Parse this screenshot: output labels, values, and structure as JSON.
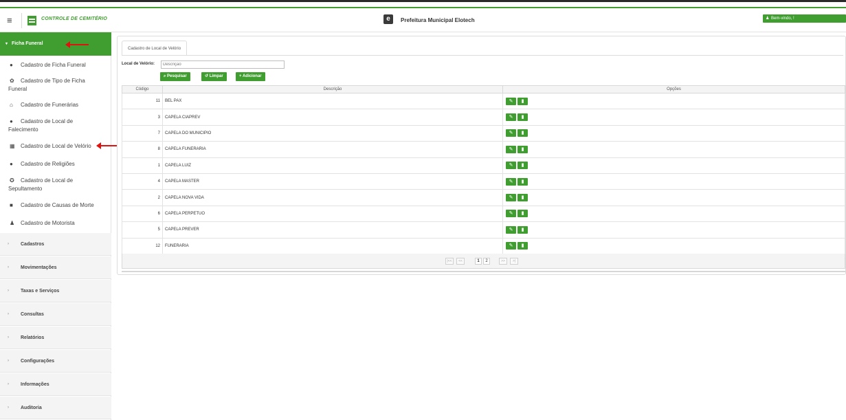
{
  "header": {
    "app_title": "CONTROLE DE CEMITÉRIO",
    "logo_letter": "e",
    "org_name": "Prefeitura Municipal Elotech",
    "welcome": "Bem-vindo, !"
  },
  "sidebar": {
    "active_group": "Ficha Funeral",
    "items": [
      {
        "label": "Cadastro de Ficha Funeral",
        "icon": "plus-circle-icon"
      },
      {
        "label1": "Cadastro de Tipo de Ficha",
        "label2": "Funeral",
        "icon": "gear-icon"
      },
      {
        "label": "Cadastro de Funerárias",
        "icon": "home-icon"
      },
      {
        "label1": "Cadastro de Local de",
        "label2": "Falecimento",
        "icon": "map-pin-icon"
      },
      {
        "label": "Cadastro de Local de Velório",
        "icon": "building-icon"
      },
      {
        "label": "Cadastro de Religiões",
        "icon": "plus-circle-icon"
      },
      {
        "label1": "Cadastro de Local de",
        "label2": "Sepultamento",
        "icon": "globe-icon"
      },
      {
        "label": "Cadastro de Causas de Morte",
        "icon": "folder-icon"
      },
      {
        "label": "Cadastro de Motorista",
        "icon": "user-icon"
      }
    ],
    "groups": [
      "Cadastros",
      "Movimentações",
      "Taxas e Serviços",
      "Consultas",
      "Relatórios",
      "Configurações",
      "Informações",
      "Auditoria"
    ]
  },
  "main": {
    "tab": "Cadastro de Local de Velório",
    "filter_label": "Local de Velório:",
    "filter_placeholder": "Descrição",
    "buttons": {
      "search": "Pesquisar",
      "clear": "Limpar",
      "add": "Adicionar"
    },
    "columns": [
      "Código",
      "Descrição",
      "Opções"
    ],
    "rows": [
      {
        "code": "11",
        "desc": "BEL PAX"
      },
      {
        "code": "3",
        "desc": "CAPELA CIAPREV"
      },
      {
        "code": "7",
        "desc": "CAPELA DO MUNICIPIO"
      },
      {
        "code": "8",
        "desc": "CAPELA FUNERARIA"
      },
      {
        "code": "1",
        "desc": "CAPELA LUIZ"
      },
      {
        "code": "4",
        "desc": "CAPELA MASTER"
      },
      {
        "code": "2",
        "desc": "CAPELA NOVA VIDA"
      },
      {
        "code": "6",
        "desc": "CAPELA PERPETUO"
      },
      {
        "code": "5",
        "desc": "CAPELA PREVER"
      },
      {
        "code": "12",
        "desc": "FUNERARIA"
      }
    ],
    "pager": {
      "first": "|<<",
      "prev": "<<",
      "page1": "1",
      "page2": "2",
      "next": ">>",
      "last": ">|"
    }
  },
  "colors": {
    "accent": "#3f9e2f",
    "arrow": "#e0120f"
  }
}
